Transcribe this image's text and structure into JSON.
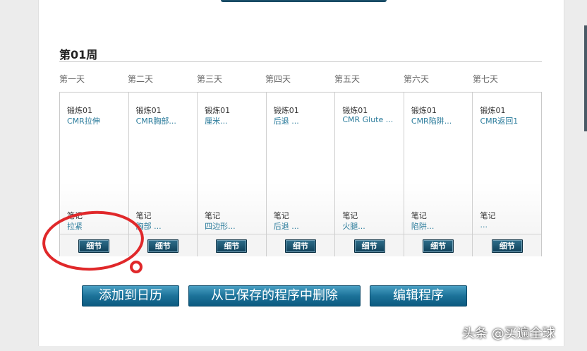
{
  "week": {
    "title": "第01周"
  },
  "days": [
    {
      "day_label": "第一天",
      "workout_label": "锻炼01",
      "workout_name": "CMR拉伸",
      "notes_label": "笔记",
      "notes_value": "拉紧",
      "detail_label": "细节"
    },
    {
      "day_label": "第二天",
      "workout_label": "锻炼01",
      "workout_name": "CMR胸部...",
      "notes_label": "笔记",
      "notes_value": "胸部 ...",
      "detail_label": "细节"
    },
    {
      "day_label": "第三天",
      "workout_label": "锻炼01",
      "workout_name": "厘米...",
      "notes_label": "笔记",
      "notes_value": "四边形...",
      "detail_label": "细节"
    },
    {
      "day_label": "第四天",
      "workout_label": "锻炼01",
      "workout_name": "后退 ...",
      "notes_label": "笔记",
      "notes_value": "后退 ...",
      "detail_label": "细节"
    },
    {
      "day_label": "第五天",
      "workout_label": "锻炼01",
      "workout_name": "CMR Glute ...",
      "notes_label": "笔记",
      "notes_value": "火腿...",
      "detail_label": "细节"
    },
    {
      "day_label": "第六天",
      "workout_label": "锻炼01",
      "workout_name": "CMR陷阱...",
      "notes_label": "笔记",
      "notes_value": "陷阱...",
      "detail_label": "细节"
    },
    {
      "day_label": "第七天",
      "workout_label": "锻炼01",
      "workout_name": "CMR返回1",
      "notes_label": "笔记",
      "notes_value": "...",
      "detail_label": "细节"
    }
  ],
  "actions": {
    "add_to_calendar": "添加到日历",
    "remove_saved": "从已保存的程序中删除",
    "edit_program": "编辑程序"
  },
  "watermark": "头条 @买遍全球",
  "colors": {
    "link": "#2a7b9b",
    "button_dark": "#0f3f58",
    "action_button": "#1c7299",
    "annotation_red": "#e0282a"
  }
}
